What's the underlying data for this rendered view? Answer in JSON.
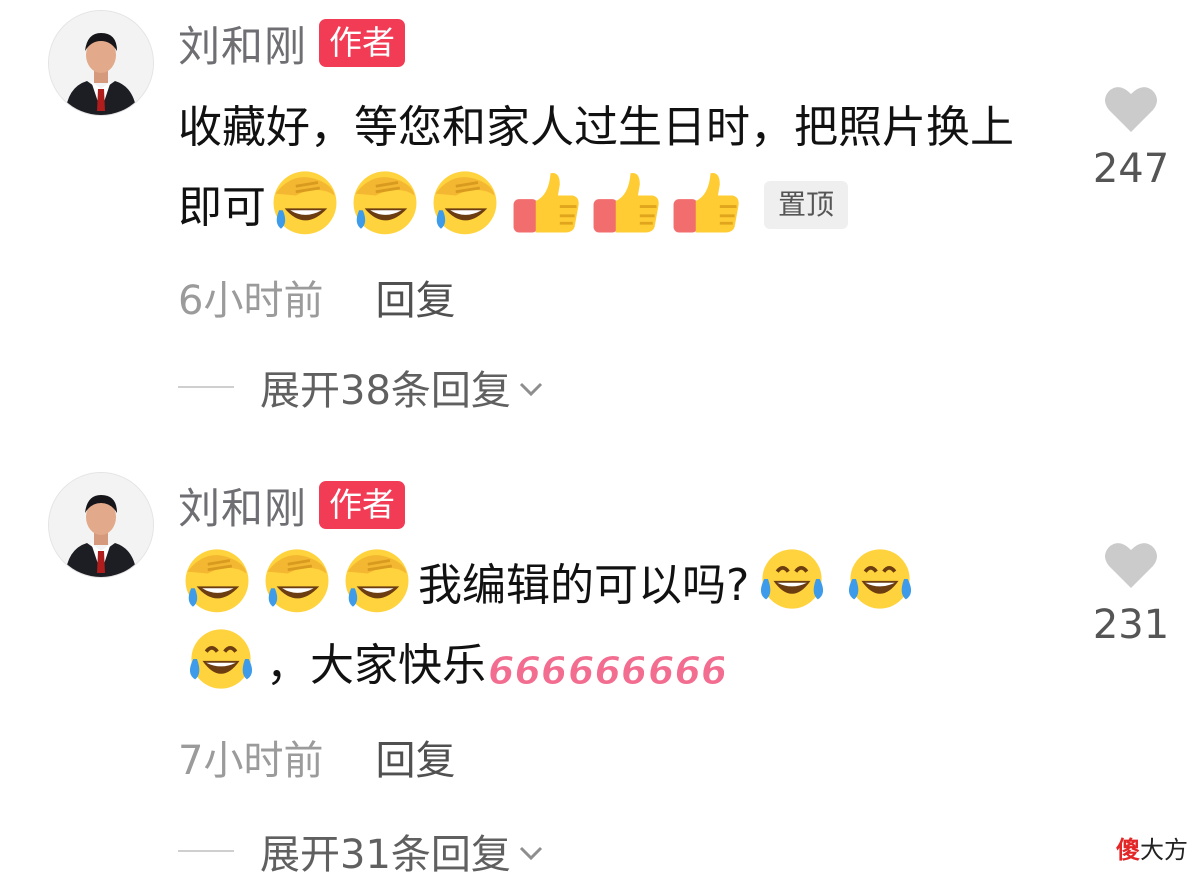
{
  "comments": [
    {
      "username": "刘和刚",
      "badge": "作者",
      "text_part1": "收藏好，等您和家人过生日时，把照片换上即可",
      "pin_label": "置顶",
      "likes": "247",
      "time": "6小时前",
      "reply_label": "回复",
      "expand_label": "展开38条回复"
    },
    {
      "username": "刘和刚",
      "badge": "作者",
      "text_part1": "我编辑的可以吗?",
      "text_part2": "，大家快乐",
      "likes": "231",
      "time": "7小时前",
      "reply_label": "回复",
      "expand_label": "展开31条回复"
    }
  ],
  "emoji_text": "666",
  "icons": [
    "heart-icon",
    "chevron-down-icon",
    "facepalm-laugh-emoji",
    "thumbs-up-emoji",
    "tears-of-joy-emoji",
    "number-666-emoji"
  ],
  "colors": {
    "author_badge": "#f23b55",
    "emoji_666": "#f26d8f"
  },
  "watermark": {
    "red_char": "傻",
    "rest": "大方"
  }
}
